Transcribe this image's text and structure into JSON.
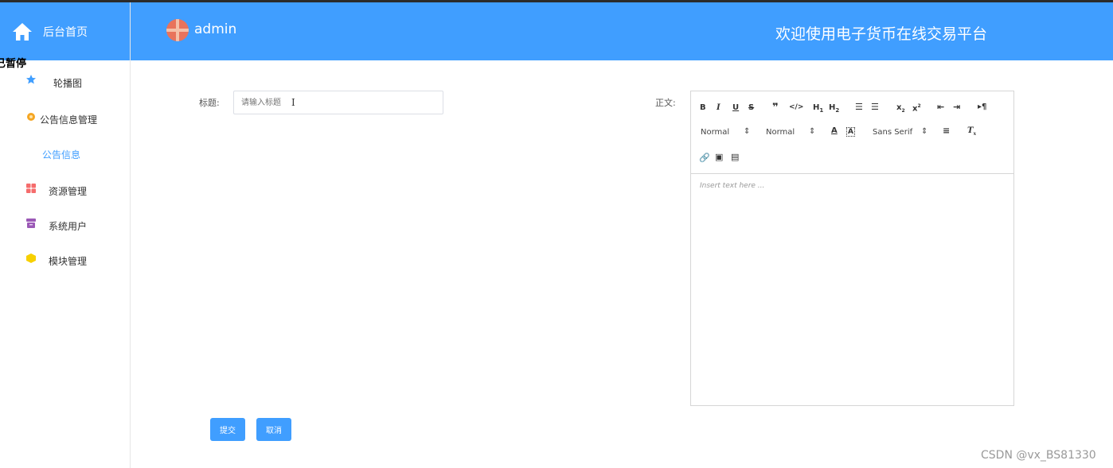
{
  "sidebar": {
    "brand_label": "后台首页",
    "ghost_text": "已暂停",
    "items": [
      {
        "label": "轮播图",
        "icon": "star-icon",
        "color": "#409eff"
      },
      {
        "label": "公告信息管理",
        "icon": "gear-icon",
        "color": "#f5a623"
      },
      {
        "label": "公告信息",
        "icon": "",
        "color": "#409eff"
      },
      {
        "label": "资源管理",
        "icon": "grid-icon",
        "color": "#f56c6c"
      },
      {
        "label": "系统用户",
        "icon": "archive-icon",
        "color": "#9b59b6"
      },
      {
        "label": "模块管理",
        "icon": "cube-icon",
        "color": "#f7d000"
      }
    ]
  },
  "header": {
    "username": "admin",
    "welcome": "欢迎使用电子货币在线交易平台",
    "accent": "#409eff"
  },
  "form": {
    "title_label": "标题:",
    "title_placeholder": "请输入标题",
    "body_label": "正文:",
    "editor_placeholder": "Insert text here ...",
    "size_select_1": "Normal",
    "size_select_2": "Normal",
    "font_select": "Sans Serif",
    "submit_label": "提交",
    "cancel_label": "取消"
  },
  "watermark": "CSDN @vx_BS81330"
}
